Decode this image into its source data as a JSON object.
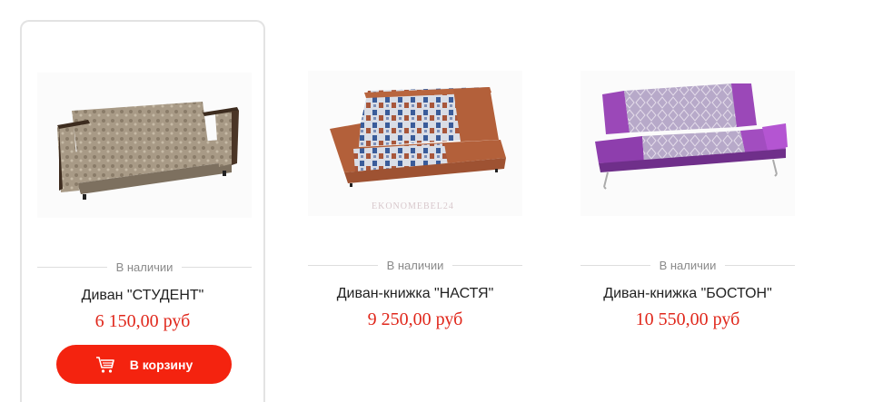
{
  "products": [
    {
      "availability": "В наличии",
      "title": "Диван \"СТУДЕНТ\"",
      "price": "6 150,00 руб",
      "cart_label": "В корзину",
      "image_icon": "sofa-student-image"
    },
    {
      "availability": "В наличии",
      "title": "Диван-книжка \"НАСТЯ\"",
      "price": "9 250,00 руб",
      "image_icon": "sofa-nastya-image",
      "watermark": "EKONOMEBEL24"
    },
    {
      "availability": "В наличии",
      "title": "Диван-книжка \"БОСТОН\"",
      "price": "10 550,00 руб",
      "image_icon": "sofa-boston-image"
    }
  ],
  "colors": {
    "price": "#e0271b",
    "cart_button": "#f4230f",
    "card_border": "#e3e3e3"
  },
  "cart_icon": "cart-icon"
}
